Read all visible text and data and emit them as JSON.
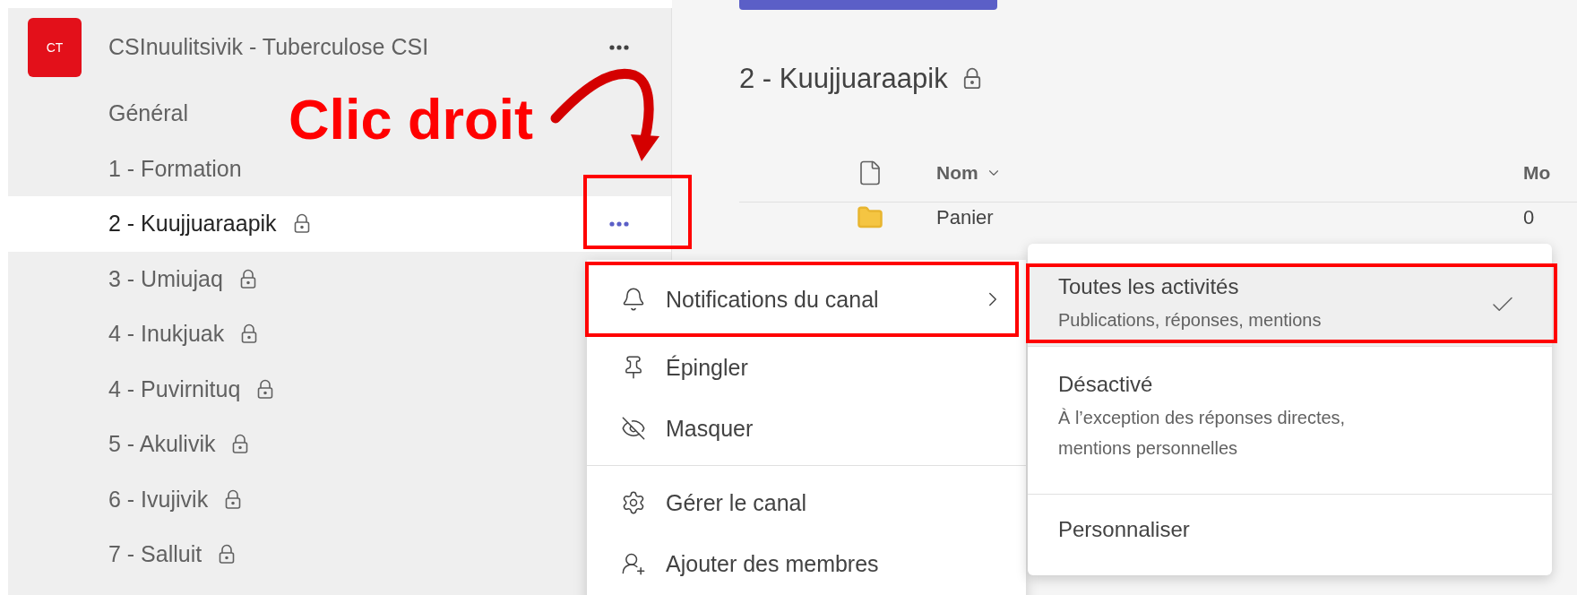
{
  "team": {
    "avatar": "CT",
    "name": "CSInuulitsivik - Tuberculose CSI"
  },
  "channels": [
    {
      "name": "Général",
      "locked": false,
      "selected": false,
      "menu_highlighted": false
    },
    {
      "name": "1 - Formation",
      "locked": false,
      "selected": false,
      "menu_highlighted": false
    },
    {
      "name": "2 - Kuujjuaraapik",
      "locked": true,
      "selected": true,
      "menu_highlighted": true
    },
    {
      "name": "3 - Umiujaq",
      "locked": true,
      "selected": false,
      "menu_highlighted": false
    },
    {
      "name": "4 - Inukjuak",
      "locked": true,
      "selected": false,
      "menu_highlighted": false
    },
    {
      "name": "4 - Puvirnituq",
      "locked": true,
      "selected": false,
      "menu_highlighted": false
    },
    {
      "name": "5 - Akulivik",
      "locked": true,
      "selected": false,
      "menu_highlighted": false
    },
    {
      "name": "6 - Ivujivik",
      "locked": true,
      "selected": false,
      "menu_highlighted": false
    },
    {
      "name": "7 - Salluit",
      "locked": true,
      "selected": false,
      "menu_highlighted": false
    }
  ],
  "content": {
    "title": "2 - Kuujjuaraapik",
    "locked": true,
    "columns": [
      {
        "label": "Nom",
        "sortable": true
      },
      {
        "label": "Mo",
        "sortable": false
      }
    ],
    "rows": [
      {
        "name": "Panier",
        "column_2": "0"
      }
    ]
  },
  "context_menu": {
    "items": [
      {
        "label": "Notifications du canal",
        "submenu": true,
        "highlighted": true,
        "divider_before": false
      },
      {
        "label": "Épingler",
        "submenu": false,
        "highlighted": false,
        "divider_before": false
      },
      {
        "label": "Masquer",
        "submenu": false,
        "highlighted": false,
        "divider_before": false
      },
      {
        "label": "Gérer le canal",
        "submenu": false,
        "highlighted": false,
        "divider_before": true
      },
      {
        "label": "Ajouter des membres",
        "submenu": false,
        "highlighted": false,
        "divider_before": false
      }
    ]
  },
  "submenu": {
    "items": [
      {
        "label": "Toutes les activités",
        "description": "Publications, réponses, mentions",
        "selected": true,
        "highlighted": true
      },
      {
        "label": "Désactivé",
        "description": "À l’exception des réponses directes, mentions personnelles",
        "selected": false,
        "highlighted": false
      },
      {
        "label": "Personnaliser",
        "selected": false,
        "highlighted": false
      }
    ]
  },
  "annotation": {
    "label": "Clic droit"
  }
}
